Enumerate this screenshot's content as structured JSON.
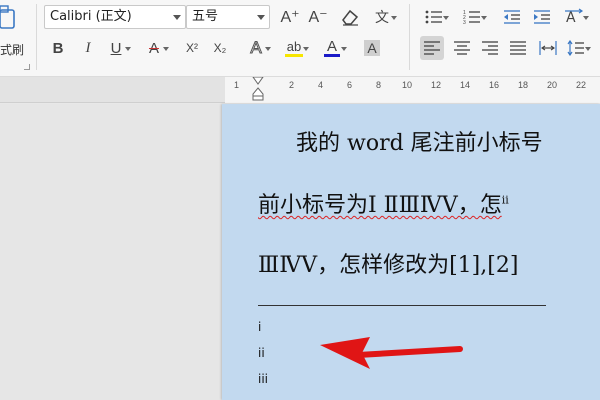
{
  "ribbon": {
    "format_painter_label": "式刷",
    "font_name": "Calibri (正文)",
    "font_size": "五号",
    "buttons": {
      "grow_font": "A⁺",
      "shrink_font": "A⁻",
      "bold": "B",
      "italic": "I",
      "underline": "U",
      "strikethrough": "A",
      "superscript": "X²",
      "subscript": "X₂",
      "text_effect": "A",
      "highlight": "ab",
      "font_color": "A",
      "char_shading": "A",
      "phonetic_glyph": "文"
    },
    "colors": {
      "highlight": "#f7e600",
      "font_color": "#1a1ac8",
      "active": "#d4d4d4"
    }
  },
  "ruler": {
    "numbers": [
      "1",
      "2",
      "4",
      "6",
      "8",
      "10",
      "12",
      "14",
      "16",
      "18",
      "20",
      "22"
    ]
  },
  "document": {
    "line1": "我的 word 尾注前小标号",
    "line2a": "前小标号为Ⅰ ⅡⅢⅣⅤ，怎",
    "line2_sup": "ii",
    "line3": "ⅢⅣⅤ，怎样修改为[1],[2]",
    "footnotes": [
      "i",
      "ii",
      "iii"
    ],
    "page_color": "#c2d9ef"
  },
  "annotation": {
    "arrow_color": "#e01515"
  }
}
